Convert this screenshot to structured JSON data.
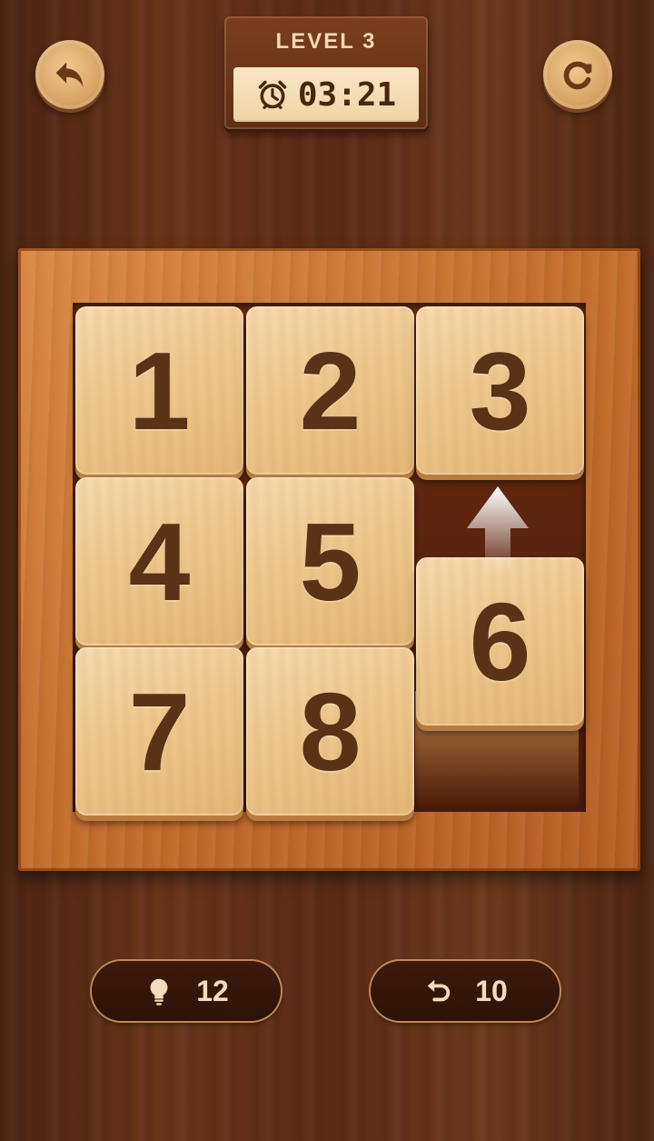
{
  "header": {
    "level_label": "LEVEL  3",
    "timer": "03:21"
  },
  "icons": {
    "back": "back-arrow-icon",
    "restart": "restart-icon",
    "clock": "alarm-clock-icon",
    "hint": "lightbulb-icon",
    "undo": "undo-icon",
    "move_hint": "up-arrow-icon"
  },
  "board": {
    "size": "3x3",
    "tiles": [
      "1",
      "2",
      "3",
      "4",
      "5",
      "6",
      "7",
      "8"
    ],
    "empty_position": "row 2, column 3",
    "moving_tile": "6",
    "move_direction": "up"
  },
  "counters": {
    "hints": "12",
    "undos": "10"
  },
  "colors": {
    "background": "#5c2c15",
    "frame": "#c46f2f",
    "tile": "#efc88f",
    "tile_number": "#5b3216",
    "pill": "#2d1307",
    "pill_text": "#f3dcbc"
  }
}
